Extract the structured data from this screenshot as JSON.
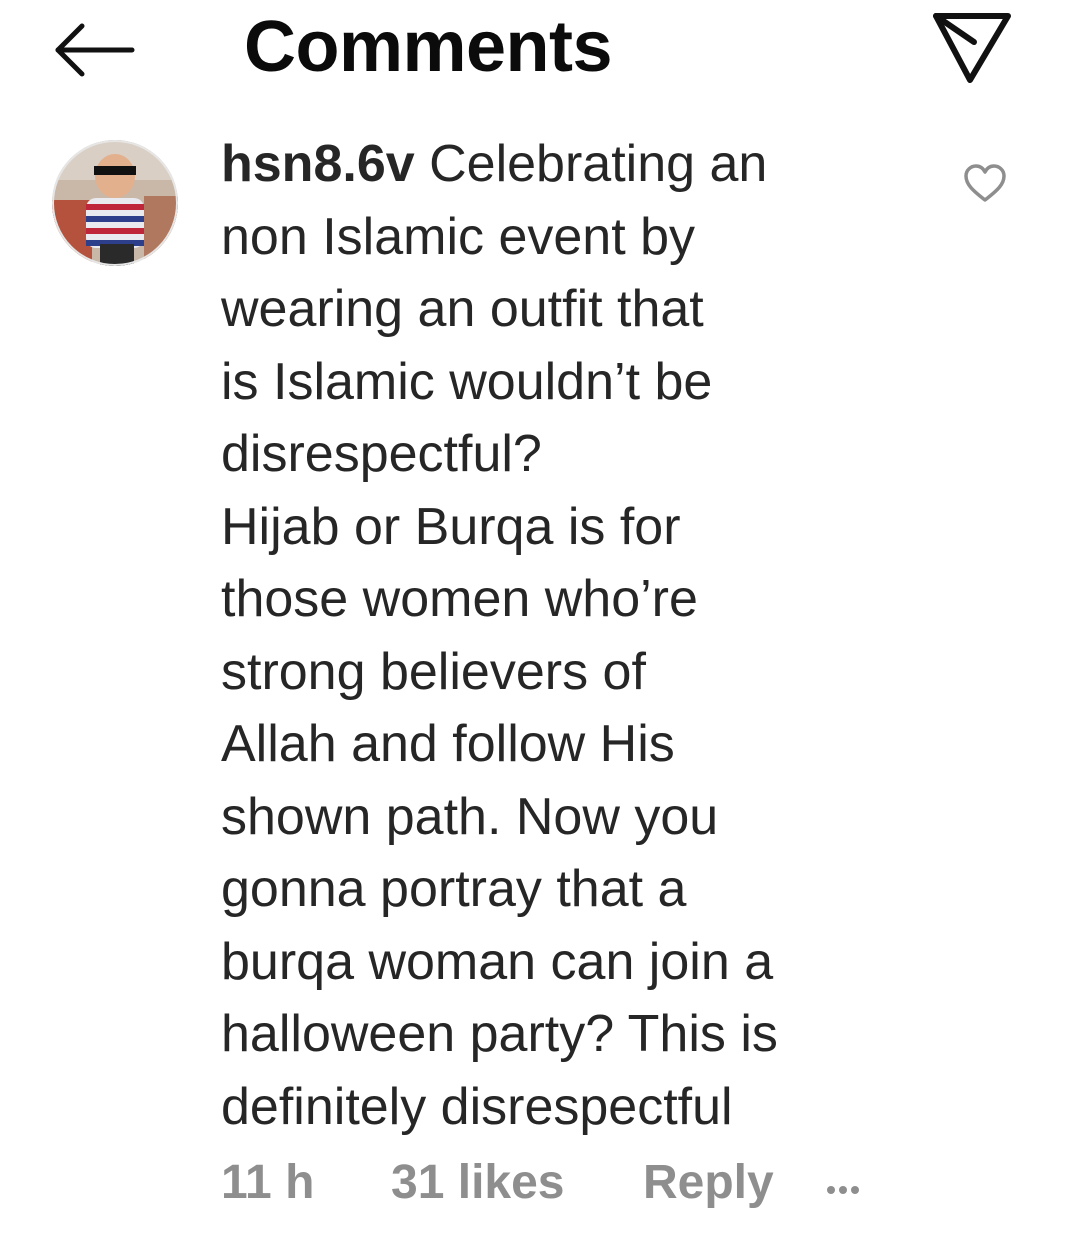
{
  "header": {
    "title": "Comments",
    "back_icon": "arrow-left-icon",
    "send_icon": "send-direct-icon"
  },
  "comment": {
    "username": "hsn8.6v",
    "text": " Celebrating an\nnon Islamic event by\nwearing an outfit that\nis Islamic wouldn’t be\ndisrespectful?\nHijab or Burqa is for\nthose women who’re\nstrong believers of\nAllah and follow His\nshown path. Now you\ngonna portray that a\nburqa woman can join a\nhalloween party? This is\ndefinitely disrespectful",
    "time": "11 h",
    "likes": "31 likes",
    "reply_label": "Reply",
    "more_icon": "more-dots-icon",
    "like_icon": "heart-outline-icon",
    "avatar_icon": "profile-photo"
  },
  "colors": {
    "text": "#262626",
    "secondary": "#8e8e8e",
    "background": "#ffffff"
  }
}
